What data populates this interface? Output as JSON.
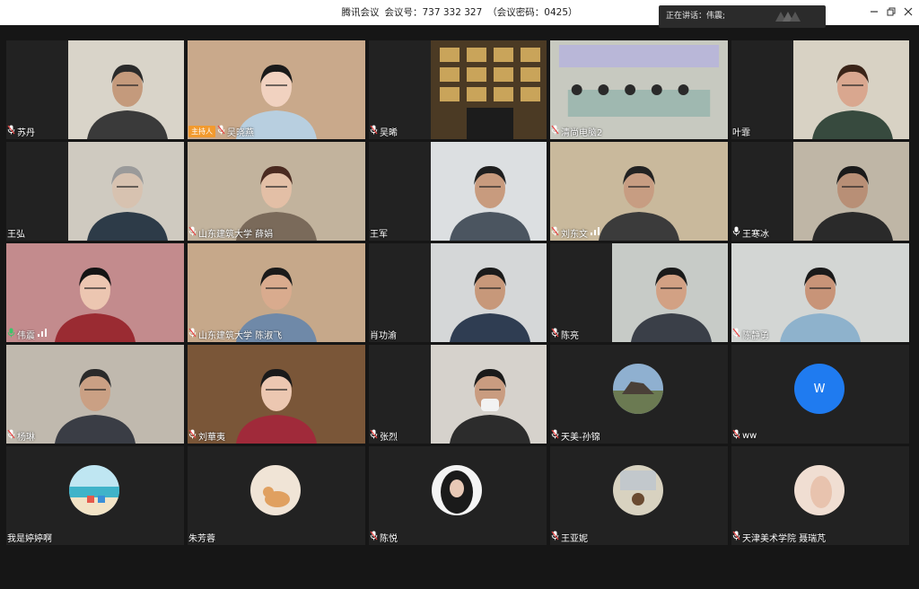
{
  "window": {
    "app_name": "腾讯会议",
    "meeting_id": "会议号：737 332 327",
    "password": "（会议密码：0425）"
  },
  "speaking_banner": "正在讲话：伟震;",
  "colors": {
    "tile_bg": "#222222",
    "host_badge": "#f29a2e",
    "avatar_blue": "#1f7bf0",
    "background": "#161616"
  },
  "participants": [
    {
      "name": "苏丹",
      "mic": true,
      "host": false
    },
    {
      "name": "吴晓燕",
      "mic": true,
      "host": true,
      "host_label": "主持人"
    },
    {
      "name": "吴晞",
      "mic": true,
      "host": false
    },
    {
      "name": "清尚电脑2",
      "mic": true,
      "host": false
    },
    {
      "name": "叶霏",
      "mic": false,
      "host": false
    },
    {
      "name": "王弘",
      "mic": false,
      "host": false
    },
    {
      "name": "山东建筑大学 薛娟",
      "mic": true,
      "host": false
    },
    {
      "name": "王军",
      "mic": false,
      "host": false
    },
    {
      "name": "刘东文",
      "mic": true,
      "host": false,
      "signal": true
    },
    {
      "name": "王寒冰",
      "mic": true,
      "mic_style": "white",
      "host": false
    },
    {
      "name": "伟震",
      "mic": true,
      "mic_style": "green",
      "host": false,
      "signal": true
    },
    {
      "name": "山东建筑大学 陈淑飞",
      "mic": true,
      "host": false
    },
    {
      "name": "肖功渝",
      "mic": false,
      "host": false
    },
    {
      "name": "陈亮",
      "mic": true,
      "host": false
    },
    {
      "name": "陈静勇",
      "mic": true,
      "host": false
    },
    {
      "name": "杨琳",
      "mic": true,
      "host": false
    },
    {
      "name": "刘華夷",
      "mic": true,
      "host": false
    },
    {
      "name": "张烈",
      "mic": true,
      "host": false
    },
    {
      "name": "天美-孙锦",
      "mic": true,
      "host": false
    },
    {
      "name": "ww",
      "mic": true,
      "host": false,
      "avatar_letter": "W"
    },
    {
      "name": "我是婷婷啊",
      "mic": false,
      "host": false
    },
    {
      "name": "朱芳蓉",
      "mic": false,
      "host": false
    },
    {
      "name": "陈悦",
      "mic": true,
      "host": false
    },
    {
      "name": "王亚妮",
      "mic": true,
      "host": false
    },
    {
      "name": "天津美术学院 聂瑞芃",
      "mic": true,
      "host": false
    }
  ]
}
